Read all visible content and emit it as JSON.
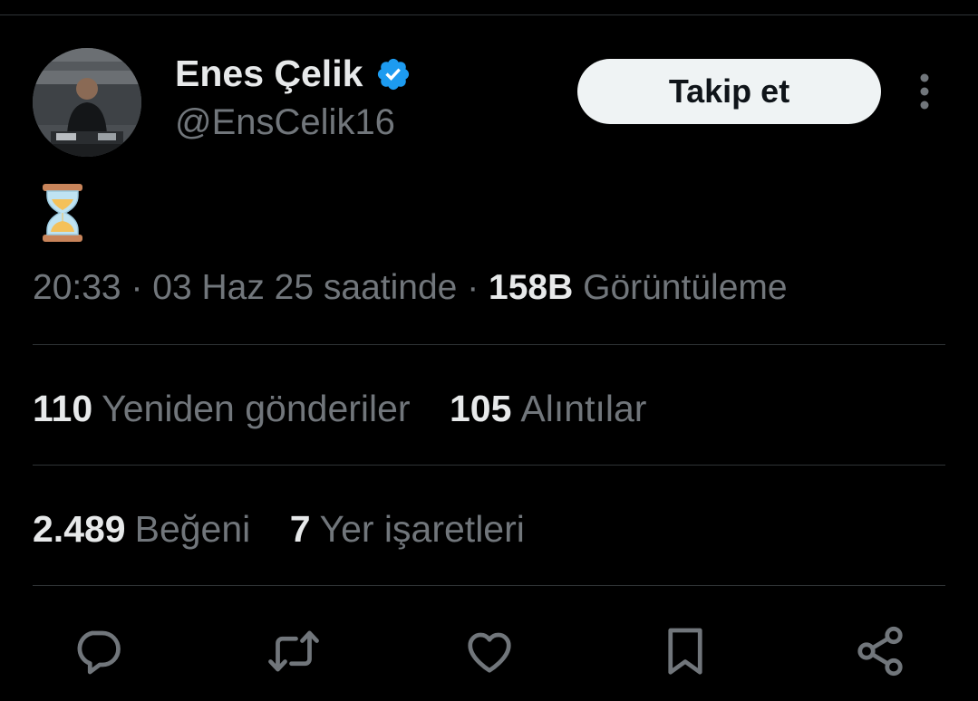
{
  "author": {
    "name": "Enes Çelik",
    "handle": "@EnsCelik16"
  },
  "follow_label": "Takip et",
  "tweet": {
    "text": "⌛"
  },
  "meta": {
    "time": "20:33",
    "separator1": " · ",
    "date": "03 Haz 25 saatinde",
    "separator2": " · ",
    "views_count": "158B",
    "views_label": "Görüntüleme"
  },
  "stats": {
    "reposts_count": "110",
    "reposts_label": "Yeniden gönderiler",
    "quotes_count": "105",
    "quotes_label": "Alıntılar",
    "likes_count": "2.489",
    "likes_label": "Beğeni",
    "bookmarks_count": "7",
    "bookmarks_label": "Yer işaretleri"
  },
  "actions": [
    {
      "icon": "reply-icon"
    },
    {
      "icon": "retweet-icon"
    },
    {
      "icon": "like-icon"
    },
    {
      "icon": "bookmark-icon"
    },
    {
      "icon": "share-icon"
    }
  ],
  "colors": {
    "background": "#000000",
    "primary_text": "#e7e9ea",
    "secondary_text": "#71767b",
    "verified_badge": "#1d9bf0",
    "divider": "#2f3336",
    "follow_button_bg": "#eff3f4"
  }
}
